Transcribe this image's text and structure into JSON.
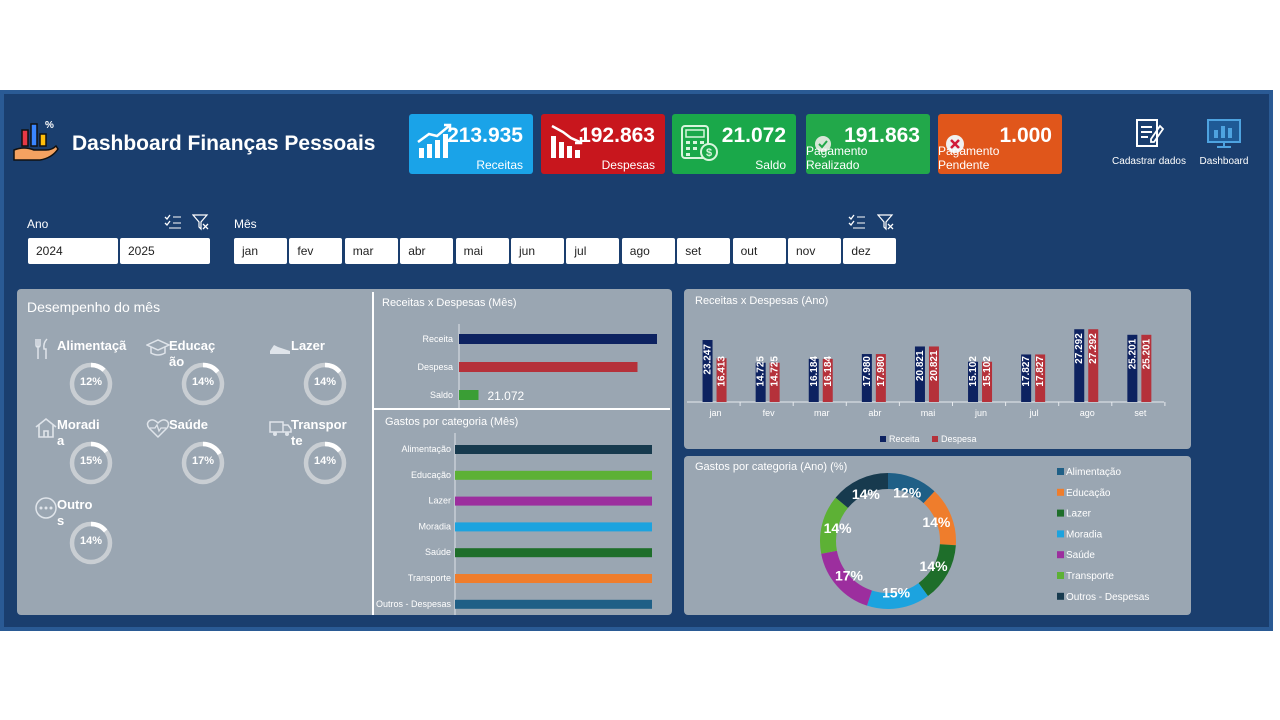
{
  "header": {
    "title": "Dashboard Finanças Pessoais",
    "kpis": [
      {
        "value": "213.935",
        "label": "Receitas",
        "color": "#1aa3e8",
        "icon": "trend-up-chart-icon"
      },
      {
        "value": "192.863",
        "label": "Despesas",
        "color": "#c8161d",
        "icon": "trend-down-chart-icon"
      },
      {
        "value": "21.072",
        "label": "Saldo",
        "color": "#1aa84a",
        "icon": "calculator-icon"
      },
      {
        "value": "191.863",
        "label": "Pagamento Realizado",
        "color": "#22a84a",
        "icon": "check-circle-icon"
      },
      {
        "value": "1.000",
        "label": "Pagamento Pendente",
        "color": "#e0561b",
        "icon": "x-circle-icon"
      }
    ],
    "nav": [
      {
        "label": "Cadastrar dados",
        "icon": "form-edit-icon"
      },
      {
        "label": "Dashboard",
        "icon": "monitor-chart-icon"
      }
    ]
  },
  "filters": {
    "year_label": "Ano",
    "years": [
      "2024",
      "2025"
    ],
    "month_label": "Mês",
    "months": [
      "jan",
      "fev",
      "mar",
      "abr",
      "mai",
      "jun",
      "jul",
      "ago",
      "set",
      "out",
      "nov",
      "dez"
    ]
  },
  "performance": {
    "title": "Desempenho do mês",
    "categories": [
      {
        "name": "Alimentação",
        "pct": "12%",
        "value": 12,
        "icon": "cutlery-icon"
      },
      {
        "name": "Educação",
        "pct": "14%",
        "value": 14,
        "icon": "graduation-cap-icon"
      },
      {
        "name": "Lazer",
        "pct": "14%",
        "value": 14,
        "icon": "sneaker-icon"
      },
      {
        "name": "Moradia",
        "pct": "15%",
        "value": 15,
        "icon": "house-icon"
      },
      {
        "name": "Saúde",
        "pct": "17%",
        "value": 17,
        "icon": "heartbeat-icon"
      },
      {
        "name": "Transporte",
        "pct": "14%",
        "value": 14,
        "icon": "truck-icon"
      },
      {
        "name": "Outros",
        "pct": "14%",
        "value": 14,
        "icon": "more-dots-icon"
      }
    ]
  },
  "chart_data": [
    {
      "type": "bar",
      "title": "Receitas x Despesas (Mês)",
      "orientation": "horizontal",
      "categories": [
        "Receita",
        "Despesa",
        "Saldo"
      ],
      "values": [
        213935,
        192863,
        21072
      ],
      "data_labels": [
        "",
        "",
        "21.072"
      ],
      "colors": [
        "#0d2260",
        "#b5313a",
        "#3a9e35"
      ]
    },
    {
      "type": "bar",
      "title": "Gastos por categoria (Mês)",
      "orientation": "horizontal",
      "categories": [
        "Alimentação",
        "Educação",
        "Lazer",
        "Moradia",
        "Saúde",
        "Transporte",
        "Outros - Despesas"
      ],
      "values": [
        1,
        1,
        1,
        1,
        1,
        1,
        1
      ],
      "colors": [
        "#173a4e",
        "#5db135",
        "#9c2e9e",
        "#1ca3df",
        "#1e6e2a",
        "#ef7d2c",
        "#1f5f86"
      ]
    },
    {
      "type": "bar",
      "title": "Receitas x Despesas (Ano)",
      "categories": [
        "jan",
        "fev",
        "mar",
        "abr",
        "mai",
        "jun",
        "jul",
        "ago",
        "set"
      ],
      "series": [
        {
          "name": "Receita",
          "values": [
            23247,
            14725,
            16184,
            17980,
            20821,
            15102,
            17827,
            27292,
            25201
          ],
          "labels": [
            "23.247",
            "14.725",
            "16.184",
            "17.980",
            "20.821",
            "15.102",
            "17.827",
            "27.292",
            "25.201"
          ],
          "color": "#0d2260"
        },
        {
          "name": "Despesa",
          "values": [
            16413,
            14725,
            16184,
            17980,
            20821,
            15102,
            17827,
            27292,
            25201
          ],
          "labels": [
            "16.413",
            "14.725",
            "16.184",
            "17.980",
            "20.821",
            "15.102",
            "17.827",
            "27.292",
            "25.201"
          ],
          "color": "#b5313a"
        }
      ],
      "legend": "bottom"
    },
    {
      "type": "pie",
      "title": "Gastos por categoria (Ano) (%)",
      "donut": true,
      "categories": [
        "Alimentação",
        "Educação",
        "Lazer",
        "Moradia",
        "Saúde",
        "Transporte",
        "Outros - Despesas"
      ],
      "values": [
        12,
        14,
        14,
        15,
        17,
        14,
        14
      ],
      "labels": [
        "12%",
        "14%",
        "14%",
        "15%",
        "17%",
        "14%",
        "14%"
      ],
      "colors": [
        "#1f5f86",
        "#ef7d2c",
        "#1e6e2a",
        "#1ca3df",
        "#9c2e9e",
        "#5db135",
        "#173a4e"
      ],
      "legend": "right"
    }
  ]
}
